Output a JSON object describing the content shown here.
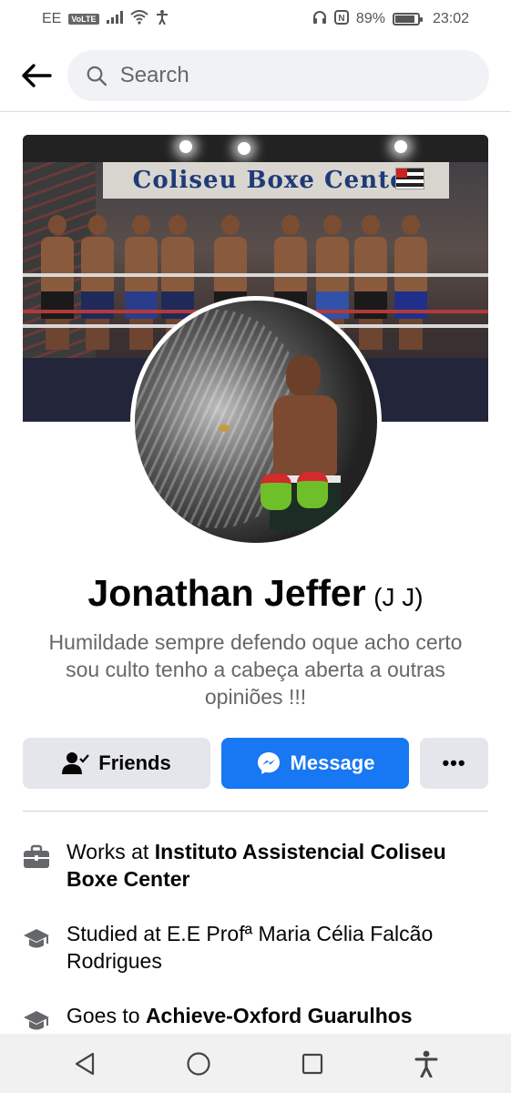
{
  "status_bar": {
    "carrier": "EE",
    "volte": "VoLTE",
    "battery": "89%",
    "battery_level": 0.89,
    "time": "23:02",
    "nfc": "N"
  },
  "header": {
    "search_placeholder": "Search"
  },
  "cover": {
    "banner_text": "Coliseu Boxe Center"
  },
  "profile": {
    "name": "Jonathan Jeffer",
    "alt_name": "(J J)",
    "bio": "Humildade sempre defendo oque acho certo sou culto tenho a cabeça aberta a outras opiniões !!!"
  },
  "actions": {
    "friends_label": "Friends",
    "message_label": "Message",
    "more_label": "•••"
  },
  "details": {
    "work_prefix": "Works at ",
    "work_place": "Instituto Assistencial Coliseu Boxe Center",
    "studied_prefix": "Studied at ",
    "studied_place": "E.E Profª Maria Célia Falcão Rodrigues",
    "goes_prefix": "Goes to ",
    "goes_place": "Achieve-Oxford Guarulhos"
  },
  "colors": {
    "accent": "#1877f2",
    "button_gray": "#e4e6eb",
    "secondary_text": "#65676b"
  },
  "icons": [
    "back-arrow-icon",
    "search-icon",
    "wifi-icon",
    "signal-icon",
    "accessibility-icon",
    "headset-icon",
    "nfc-icon",
    "battery-icon",
    "friends-check-icon",
    "messenger-icon",
    "briefcase-icon",
    "graduation-cap-icon",
    "back-triangle-icon",
    "home-circle-icon",
    "recents-square-icon"
  ]
}
